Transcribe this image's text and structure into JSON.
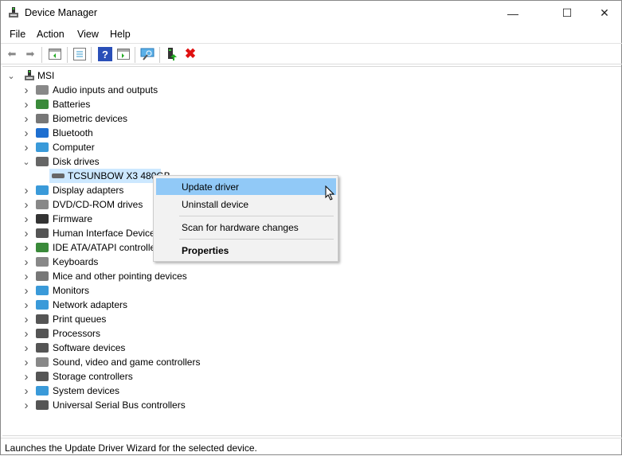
{
  "window": {
    "title": "Device Manager",
    "minimize": "—",
    "maximize": "☐",
    "close": "✕"
  },
  "menubar": [
    "File",
    "Action",
    "View",
    "Help"
  ],
  "toolbar": [
    "back-icon",
    "forward-icon",
    "show-hide-console-tree-icon",
    "properties-icon",
    "help-icon",
    "action-pane-icon",
    "scan-hardware-icon",
    "update-driver-icon",
    "uninstall-icon"
  ],
  "tree": {
    "root": "MSI",
    "items": [
      {
        "label": "Audio inputs and outputs",
        "icon": "speaker-icon",
        "color": "#888"
      },
      {
        "label": "Batteries",
        "icon": "battery-icon",
        "color": "#3a8a3a"
      },
      {
        "label": "Biometric devices",
        "icon": "fingerprint-icon",
        "color": "#777"
      },
      {
        "label": "Bluetooth",
        "icon": "bluetooth-icon",
        "color": "#1e6fd0"
      },
      {
        "label": "Computer",
        "icon": "computer-icon",
        "color": "#3a9ad9"
      },
      {
        "label": "Disk drives",
        "icon": "disk-drive-icon",
        "color": "#666",
        "expanded": true,
        "children": [
          {
            "label": "TCSUNBOW X3 480GB",
            "icon": "disk-drive-icon",
            "selected": true
          }
        ]
      },
      {
        "label": "Display adapters",
        "icon": "display-adapter-icon",
        "color": "#3a9ad9"
      },
      {
        "label": "DVD/CD-ROM drives",
        "icon": "dvd-drive-icon",
        "color": "#888"
      },
      {
        "label": "Firmware",
        "icon": "chip-icon",
        "color": "#333"
      },
      {
        "label": "Human Interface Devices",
        "icon": "keyboard-icon",
        "color": "#555"
      },
      {
        "label": "IDE ATA/ATAPI controllers",
        "icon": "controller-icon",
        "color": "#3a8a3a"
      },
      {
        "label": "Keyboards",
        "icon": "keyboard-icon",
        "color": "#888"
      },
      {
        "label": "Mice and other pointing devices",
        "icon": "mouse-icon",
        "color": "#777"
      },
      {
        "label": "Monitors",
        "icon": "monitor-icon",
        "color": "#3a9ad9"
      },
      {
        "label": "Network adapters",
        "icon": "network-icon",
        "color": "#3a9ad9"
      },
      {
        "label": "Print queues",
        "icon": "printer-icon",
        "color": "#555"
      },
      {
        "label": "Processors",
        "icon": "processor-icon",
        "color": "#555"
      },
      {
        "label": "Software devices",
        "icon": "software-device-icon",
        "color": "#555"
      },
      {
        "label": "Sound, video and game controllers",
        "icon": "speaker-icon",
        "color": "#888"
      },
      {
        "label": "Storage controllers",
        "icon": "storage-controller-icon",
        "color": "#555"
      },
      {
        "label": "System devices",
        "icon": "system-icon",
        "color": "#3a9ad9"
      },
      {
        "label": "Universal Serial Bus controllers",
        "icon": "usb-icon",
        "color": "#555"
      }
    ]
  },
  "context_menu": {
    "items": [
      "Update driver",
      "Uninstall device",
      "Scan for hardware changes",
      "Properties"
    ],
    "highlighted": "Update driver"
  },
  "status": "Launches the Update Driver Wizard for the selected device."
}
